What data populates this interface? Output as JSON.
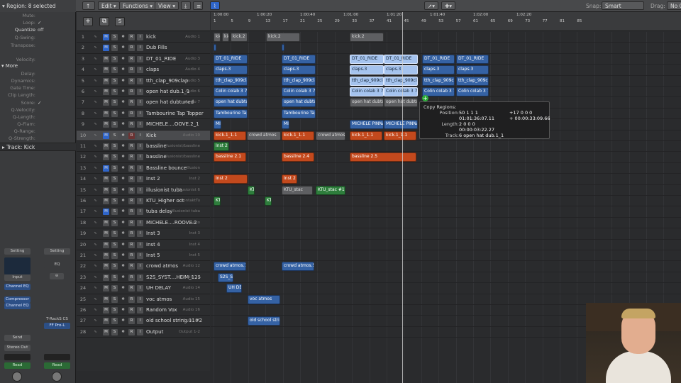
{
  "header": {
    "region_label": "Region: 8 selected",
    "menus": [
      "Edit",
      "Functions",
      "View"
    ],
    "snap_label": "Snap:",
    "snap_value": "Smart",
    "drag_label": "Drag:",
    "drag_value": "No O"
  },
  "inspector": {
    "rows": [
      {
        "k": "Mute:",
        "v": ""
      },
      {
        "k": "Loop:",
        "v": "✓"
      },
      {
        "k": "Quantize",
        "v": "off"
      },
      {
        "k": "Q-Swing:",
        "v": ""
      },
      {
        "k": "Transpose:",
        "v": ""
      },
      {
        "k": "Velocity:",
        "v": ""
      }
    ],
    "more_label": "More",
    "more_rows": [
      {
        "k": "Delay:",
        "v": ""
      },
      {
        "k": "Dynamics:",
        "v": ""
      },
      {
        "k": "Gate Time:",
        "v": ""
      },
      {
        "k": "Clip Length:",
        "v": ""
      },
      {
        "k": "Score:",
        "v": "✓"
      },
      {
        "k": "Q-Velocity:",
        "v": ""
      },
      {
        "k": "Q-Length:",
        "v": ""
      },
      {
        "k": "Q-Flam:",
        "v": ""
      },
      {
        "k": "Q-Range:",
        "v": ""
      },
      {
        "k": "Q-Strength:",
        "v": ""
      }
    ],
    "track_label": "Track:  Kick"
  },
  "channel_strips": {
    "left": {
      "setting": "Setting",
      "eq": "Channel EQ",
      "plugins": [
        "Compressor",
        "Channel EQ"
      ],
      "send": "Send",
      "output": "Stereo Out",
      "read": "Read"
    },
    "right": {
      "setting": "Setting",
      "eq": "EQ",
      "plugins": [
        "T-RackS CS",
        "FF Pro-L"
      ],
      "read": "Read"
    }
  },
  "tracks": [
    {
      "num": "1",
      "name": "kick",
      "out": "Audio 1"
    },
    {
      "num": "2",
      "name": "Dub Fills",
      "out": ""
    },
    {
      "num": "3",
      "name": "DT_01_RIDE",
      "out": "Audio 3"
    },
    {
      "num": "4",
      "name": "claps",
      "out": "Audio 4"
    },
    {
      "num": "5",
      "name": "tth_clap_909clap",
      "out": "Audio 5"
    },
    {
      "num": "6",
      "name": "open hat dub.1_1",
      "out": "Audio 6"
    },
    {
      "num": "7",
      "name": "open hat dubtuned",
      "out": "Audio 7"
    },
    {
      "num": "8",
      "name": "Tambourine Tap Topper",
      "out": ""
    },
    {
      "num": "9",
      "name": "MICHELE....OOVE.2_1",
      "out": ""
    },
    {
      "num": "10",
      "name": "Kick",
      "out": "Audio 10"
    },
    {
      "num": "11",
      "name": "bassline",
      "out": "Illusionist/bassline"
    },
    {
      "num": "12",
      "name": "bassline",
      "out": "Illusionist/bassline"
    },
    {
      "num": "13",
      "name": "Bassline bounce",
      "out": "Illusion"
    },
    {
      "num": "14",
      "name": "Inst 2",
      "out": "Inst 2"
    },
    {
      "num": "15",
      "name": "illusionist tuba",
      "out": "Illusionist 6"
    },
    {
      "num": "16",
      "name": "KTU_Higher oct",
      "out": "KontaktTu"
    },
    {
      "num": "17",
      "name": "tuba delay",
      "out": "Illusionist tuba"
    },
    {
      "num": "18",
      "name": "MICHELE....ROOVE.2",
      "out": "Audio"
    },
    {
      "num": "19",
      "name": "Inst 3",
      "out": "Inst 3"
    },
    {
      "num": "20",
      "name": "Inst 4",
      "out": "Inst 4"
    },
    {
      "num": "21",
      "name": "Inst 5",
      "out": "Inst 5"
    },
    {
      "num": "22",
      "name": "crowd atmos",
      "out": "Audio 12"
    },
    {
      "num": "23",
      "name": "S2S_SYST....HEIM_125",
      "out": "Audio 13"
    },
    {
      "num": "24",
      "name": "UH DELAY",
      "out": "Audio 14"
    },
    {
      "num": "25",
      "name": "voc atmos",
      "out": "Audio 15"
    },
    {
      "num": "26",
      "name": "Random Vox",
      "out": "Audio 16"
    },
    {
      "num": "27",
      "name": "old school string.11#2",
      "out": "Audio 17"
    },
    {
      "num": "28",
      "name": "Output",
      "out": "Output 1-2"
    }
  ],
  "ruler": {
    "times": [
      "1:00:00",
      "1:00:20",
      "1:00:40",
      "1:01:00",
      "1:01:20",
      "1:01:40",
      "1:02:00",
      "1:02:20"
    ],
    "bars": [
      "1",
      "5",
      "9",
      "13",
      "17",
      "21",
      "25",
      "29",
      "33",
      "37",
      "41",
      "45",
      "49",
      "53",
      "57",
      "61",
      "65",
      "69",
      "73",
      "77",
      "81",
      "85"
    ]
  },
  "regions": [
    {
      "lane": 0,
      "label": "kic",
      "style": "gr"
    },
    {
      "lane": 0,
      "label": "kic",
      "style": "gr"
    },
    {
      "lane": 0,
      "label": "kick.2",
      "style": "gr"
    },
    {
      "lane": 0,
      "label": "kick.2",
      "style": "gr"
    },
    {
      "lane": 0,
      "label": "kick.2",
      "style": "gr"
    },
    {
      "lane": 2,
      "label": "DT_01_RIDE",
      "style": "b"
    },
    {
      "lane": 2,
      "label": "DT_01_RIDE",
      "style": "b"
    },
    {
      "lane": 2,
      "label": "DT_01_RIDE",
      "style": "lb"
    },
    {
      "lane": 2,
      "label": "DT_01_RIDE",
      "style": "lb"
    },
    {
      "lane": 2,
      "label": "DT_01_RIDE",
      "style": "b"
    },
    {
      "lane": 2,
      "label": "DT_01_RIDE",
      "style": "b"
    },
    {
      "lane": 3,
      "label": "claps.3",
      "style": "b"
    },
    {
      "lane": 3,
      "label": "claps.3",
      "style": "b"
    },
    {
      "lane": 3,
      "label": "claps.3",
      "style": "lb"
    },
    {
      "lane": 3,
      "label": "claps.3",
      "style": "lb"
    },
    {
      "lane": 3,
      "label": "claps.3",
      "style": "b"
    },
    {
      "lane": 3,
      "label": "claps.3",
      "style": "b"
    },
    {
      "lane": 4,
      "label": "tth_clap_909clap",
      "style": "b"
    },
    {
      "lane": 4,
      "label": "tth_clap_909clap",
      "style": "b"
    },
    {
      "lane": 4,
      "label": "tth_clap_909clap",
      "style": "lb"
    },
    {
      "lane": 4,
      "label": "tth_clap_909clap",
      "style": "lb"
    },
    {
      "lane": 4,
      "label": "tth_clap_909clap",
      "style": "b"
    },
    {
      "lane": 4,
      "label": "tth_clap_909clap",
      "style": "b"
    },
    {
      "lane": 5,
      "label": "Colin colab 3 7",
      "style": "b"
    },
    {
      "lane": 5,
      "label": "Colin colab 3 7",
      "style": "b"
    },
    {
      "lane": 5,
      "label": "Colin colab 3 7",
      "style": "lb"
    },
    {
      "lane": 5,
      "label": "Colin colab 3 7",
      "style": "lb"
    },
    {
      "lane": 5,
      "label": "Colin colab 3 7",
      "style": "b"
    },
    {
      "lane": 5,
      "label": "Colin colab 3 7",
      "style": "b"
    },
    {
      "lane": 6,
      "label": "open hat dubtuned",
      "style": "b"
    },
    {
      "lane": 6,
      "label": "open hat dubtuned",
      "style": "b"
    },
    {
      "lane": 6,
      "label": "open hat dubtu",
      "style": "gr"
    },
    {
      "lane": 6,
      "label": "open hat dubtu",
      "style": "gr"
    },
    {
      "lane": 7,
      "label": "Tambourine Tap",
      "style": "b"
    },
    {
      "lane": 7,
      "label": "Tambourine Tap",
      "style": "b"
    },
    {
      "lane": 8,
      "label": "MIC",
      "style": "b"
    },
    {
      "lane": 8,
      "label": "MIC",
      "style": "b"
    },
    {
      "lane": 8,
      "label": "MICHELE PINNA",
      "style": "b"
    },
    {
      "lane": 8,
      "label": "MICHELE PINNA",
      "style": "b"
    },
    {
      "lane": 9,
      "label": "kick.1_1.1",
      "style": "o"
    },
    {
      "lane": 9,
      "label": "crowd atmos",
      "style": "gr"
    },
    {
      "lane": 9,
      "label": "kick.1_1.1",
      "style": "o"
    },
    {
      "lane": 9,
      "label": "crowd atmos",
      "style": "gr"
    },
    {
      "lane": 9,
      "label": "kick.1_1.1",
      "style": "o"
    },
    {
      "lane": 9,
      "label": "kick.1_1.1",
      "style": "o"
    },
    {
      "lane": 10,
      "label": "Inst 2",
      "style": "g"
    },
    {
      "lane": 11,
      "label": "bassline 2.1",
      "style": "o"
    },
    {
      "lane": 11,
      "label": "bassline 2.4",
      "style": "o"
    },
    {
      "lane": 11,
      "label": "bassline 2.5",
      "style": "o"
    },
    {
      "lane": 13,
      "label": "Inst 2",
      "style": "o"
    },
    {
      "lane": 13,
      "label": "Inst 2",
      "style": "o"
    },
    {
      "lane": 14,
      "label": "KTU",
      "style": "g"
    },
    {
      "lane": 14,
      "label": "KTU_stac",
      "style": "gr"
    },
    {
      "lane": 14,
      "label": "KTU_stac #1",
      "style": "g"
    },
    {
      "lane": 15,
      "label": "KTU",
      "style": "g"
    },
    {
      "lane": 15,
      "label": "KTU",
      "style": "g"
    },
    {
      "lane": 21,
      "label": "crowd atmos.1",
      "style": "b"
    },
    {
      "lane": 21,
      "label": "crowd atmos.5",
      "style": "b"
    },
    {
      "lane": 22,
      "label": "S2S_SY",
      "style": "b"
    },
    {
      "lane": 23,
      "label": "UH DE",
      "style": "b"
    },
    {
      "lane": 24,
      "label": "voc atmos",
      "style": "b"
    },
    {
      "lane": 26,
      "label": "old school string",
      "style": "b"
    }
  ],
  "tooltip": {
    "title": "Copy Regions:",
    "position_label": "Position:",
    "position_value": "50 1 1 1",
    "position_time": "01:01:36:07.11",
    "position_delta": "+17 0 0 0",
    "position_delta_time": "+ 00:00:33:09.66",
    "length_label": "Length:",
    "length_value": "2 0 0 0",
    "length_time": "00:00:03:22.27",
    "track_label": "Track:",
    "track_value": "6  open hat dub.1_1"
  }
}
